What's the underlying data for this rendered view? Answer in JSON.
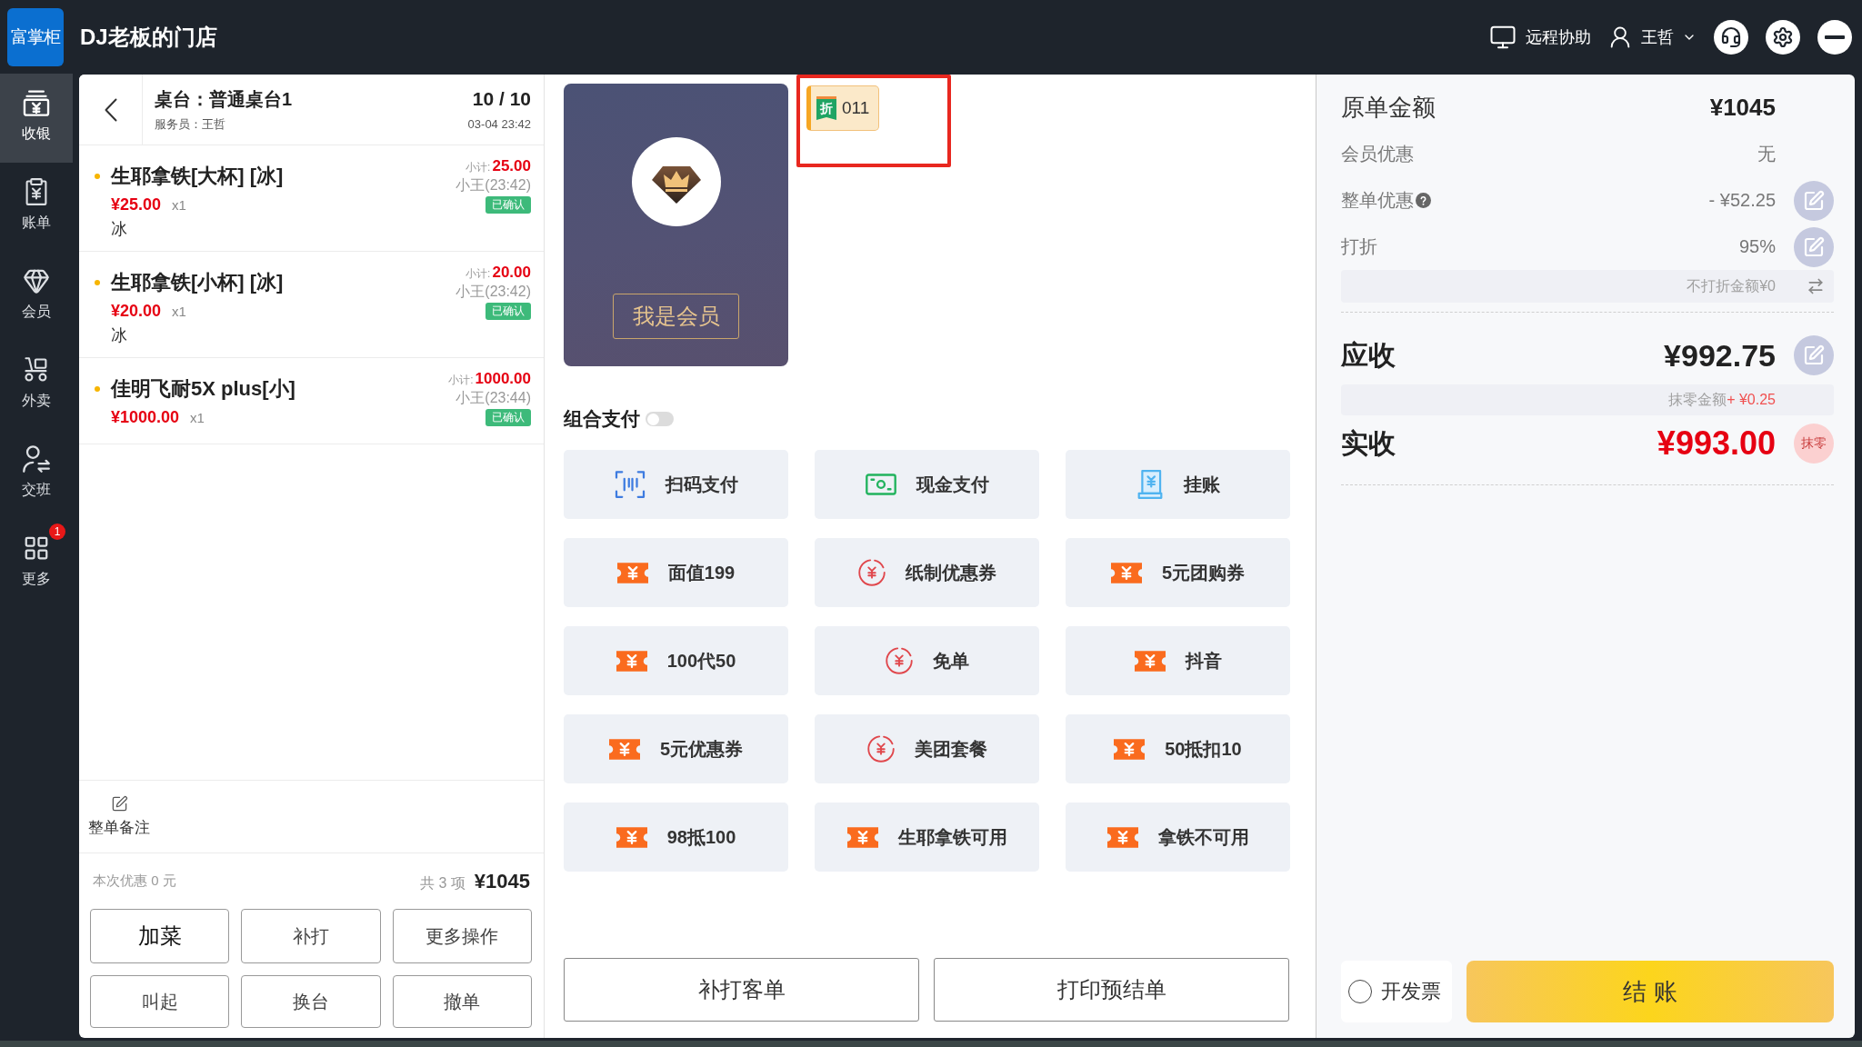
{
  "header": {
    "logo": "富掌柜",
    "store_name": "DJ老板的门店",
    "remote_assist": "远程协助",
    "user": "王哲"
  },
  "sidebar": {
    "items": [
      {
        "label": "收银",
        "selected": true
      },
      {
        "label": "账单",
        "selected": false
      },
      {
        "label": "会员",
        "selected": false
      },
      {
        "label": "外卖",
        "selected": false
      },
      {
        "label": "交班",
        "selected": false
      },
      {
        "label": "更多",
        "selected": false,
        "badge": "1"
      }
    ]
  },
  "order": {
    "table": "桌台：普通桌台1",
    "waiter": "服务员：王哲",
    "count": "10 / 10",
    "time": "03-04 23:42",
    "items": [
      {
        "name": "生耶拿铁[大杯] [冰]",
        "price": "¥25.00",
        "qty": "x1",
        "note": "冰",
        "subtotal_label": "小计:",
        "subtotal": "25.00",
        "staff": "小王(23:42)",
        "status": "已确认"
      },
      {
        "name": "生耶拿铁[小杯] [冰]",
        "price": "¥20.00",
        "qty": "x1",
        "note": "冰",
        "subtotal_label": "小计:",
        "subtotal": "20.00",
        "staff": "小王(23:42)",
        "status": "已确认"
      },
      {
        "name": "佳明飞耐5X plus[小]",
        "price": "¥1000.00",
        "qty": "x1",
        "subtotal_label": "小计:",
        "subtotal": "1000.00",
        "staff": "小王(23:44)",
        "status": "已确认"
      }
    ],
    "remark": "整单备注",
    "discount": "本次优惠 0 元",
    "item_count": "共 3 项",
    "total": "¥1045",
    "actions": [
      {
        "label": "加菜",
        "emphasis": true
      },
      {
        "label": "补打",
        "emphasis": false
      },
      {
        "label": "更多操作",
        "emphasis": false
      },
      {
        "label": "叫起",
        "emphasis": false
      },
      {
        "label": "换台",
        "emphasis": false
      },
      {
        "label": "撤单",
        "emphasis": false
      }
    ]
  },
  "member": {
    "button": "我是会员",
    "coupon": {
      "badge": "折",
      "code": "011",
      "highlighted": true
    }
  },
  "payment": {
    "combo_label": "组合支付",
    "combo_on": false,
    "methods": [
      {
        "label": "扫码支付",
        "kind": "scan"
      },
      {
        "label": "现金支付",
        "kind": "cash"
      },
      {
        "label": "挂账",
        "kind": "credit"
      },
      {
        "label": "面值199",
        "kind": "coupon"
      },
      {
        "label": "纸制优惠券",
        "kind": "voucher"
      },
      {
        "label": "5元团购券",
        "kind": "coupon"
      },
      {
        "label": "100代50",
        "kind": "coupon"
      },
      {
        "label": "免单",
        "kind": "voucher"
      },
      {
        "label": "抖音",
        "kind": "coupon"
      },
      {
        "label": "5元优惠券",
        "kind": "coupon"
      },
      {
        "label": "美团套餐",
        "kind": "voucher"
      },
      {
        "label": "50抵扣10",
        "kind": "coupon"
      },
      {
        "label": "98抵100",
        "kind": "coupon"
      },
      {
        "label": "生耶拿铁可用",
        "kind": "coupon"
      },
      {
        "label": "拿铁不可用",
        "kind": "coupon"
      }
    ],
    "print_buttons": [
      "补打客单",
      "打印预结单"
    ]
  },
  "summary": {
    "rows": [
      {
        "label": "原单金额",
        "value": "¥1045",
        "kind": "headline"
      },
      {
        "label": "会员优惠",
        "value": "无",
        "kind": "plain"
      },
      {
        "label": "整单优惠",
        "value": "- ¥52.25",
        "kind": "editable",
        "help": true
      },
      {
        "label": "打折",
        "value": "95%",
        "kind": "editable"
      }
    ],
    "non_discount": "不打折金额¥0",
    "receivable": {
      "label": "应收",
      "value": "¥992.75"
    },
    "rounding": {
      "label": "抹零金额",
      "value": "+ ¥0.25"
    },
    "received": {
      "label": "实收",
      "value": "¥993.00",
      "action": "抹零"
    },
    "invoice": {
      "label": "开发票",
      "checked": false
    },
    "checkout": "结 账"
  }
}
